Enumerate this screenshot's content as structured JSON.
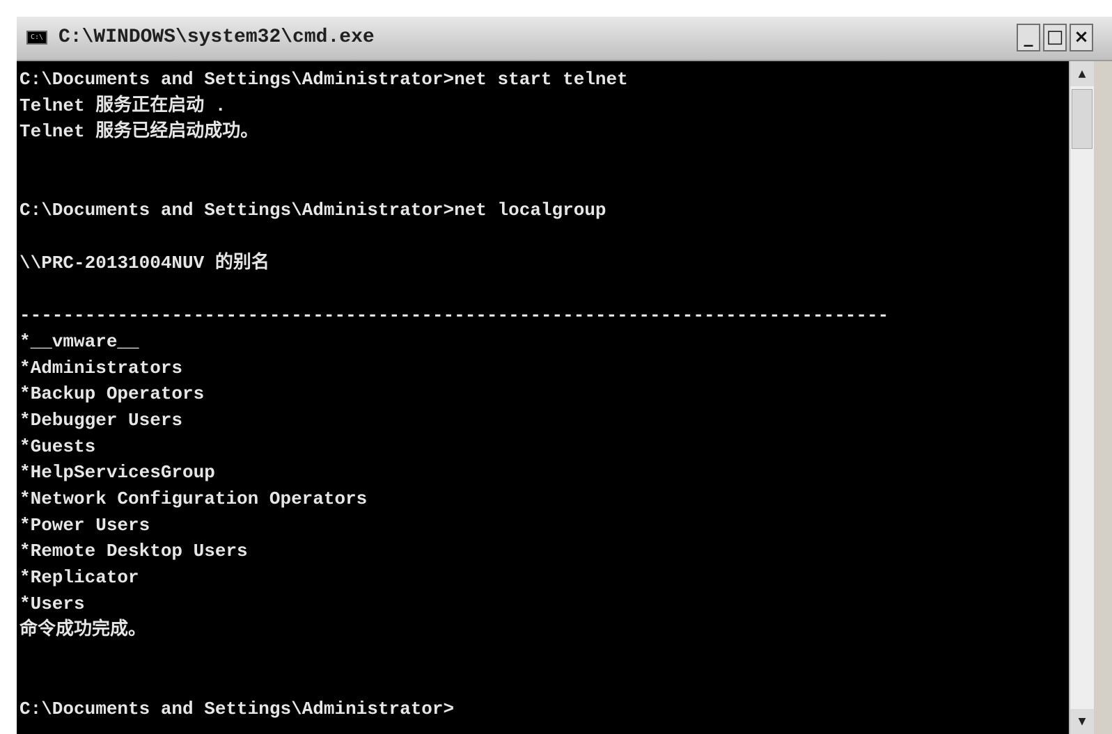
{
  "window": {
    "title": "C:\\WINDOWS\\system32\\cmd.exe",
    "icon_label": "C:\\",
    "controls": {
      "minimize": "_",
      "maximize": "□",
      "close": "×"
    }
  },
  "console": {
    "lines": [
      "C:\\Documents and Settings\\Administrator>net start telnet",
      "Telnet 服务正在启动 .",
      "Telnet 服务已经启动成功。",
      "",
      "",
      "C:\\Documents and Settings\\Administrator>net localgroup",
      "",
      "\\\\PRC-20131004NUV 的别名",
      "",
      "--------------------------------------------------------------------------------",
      "*__vmware__",
      "*Administrators",
      "*Backup Operators",
      "*Debugger Users",
      "*Guests",
      "*HelpServicesGroup",
      "*Network Configuration Operators",
      "*Power Users",
      "*Remote Desktop Users",
      "*Replicator",
      "*Users",
      "命令成功完成。",
      "",
      "",
      "C:\\Documents and Settings\\Administrator>"
    ]
  },
  "scrollbar": {
    "up_arrow": "▲",
    "down_arrow": "▼"
  }
}
